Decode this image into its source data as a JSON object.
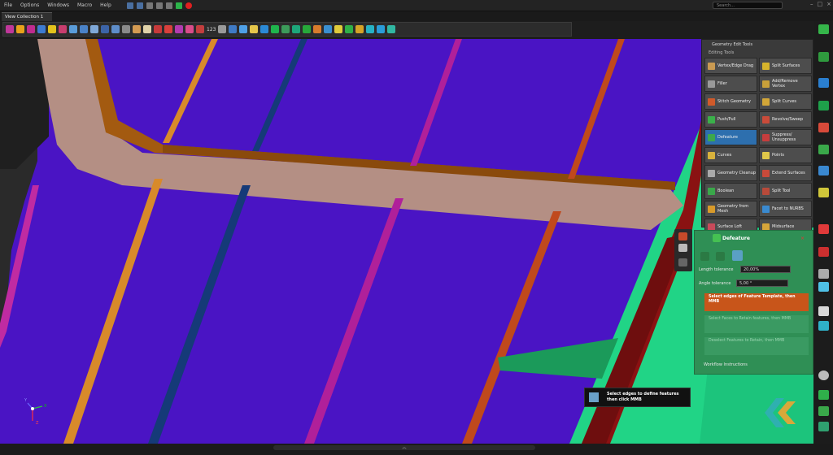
{
  "menu": {
    "items": [
      "File",
      "Options",
      "Windows",
      "Macro",
      "Help"
    ]
  },
  "search": {
    "placeholder": "Search..."
  },
  "tab": {
    "label": "View Collection 1"
  },
  "toolbar": {
    "number_label": "123"
  },
  "geometry_panel": {
    "title": "Geometry Edit Tools",
    "section": "Editing Tools",
    "tools": [
      "Vertex/Edge Drag",
      "Split Surfaces",
      "Filler",
      "Add/Remove Vertex",
      "Stitch Geometry",
      "Split Curves",
      "Push/Pull",
      "Revolve/Sweep",
      "Defeature",
      "Suppress/ Unsuppress",
      "Curves",
      "Points",
      "Geometry Cleanup",
      "Extend Surfaces",
      "Boolean",
      "Split Tool",
      "Geometry from Mesh",
      "Facet to NURBS",
      "Surface Loft",
      "Midsurface"
    ]
  },
  "defeature": {
    "title": "Defeature",
    "length_label": "Length tolerance",
    "length_value": "20,00%",
    "angle_label": "Angle tolerance",
    "angle_value": "5,00 °",
    "steps": [
      "Select edges of Feature Template, then MMB",
      "Select Faces to Retain features, then MMB",
      "Deselect Features to Retain, then MMB"
    ],
    "workflow": "Workflow Instructions"
  },
  "tooltip": {
    "line1": "Select edges to define features",
    "line2": "then click MMB"
  },
  "axis": {
    "x": "X",
    "y": "Y",
    "z": "Z"
  },
  "colors": {
    "accent": "#2d6fae",
    "panel_green": "#2f8f55",
    "active_step": "#c8551a",
    "surface": "#4a14c4"
  }
}
